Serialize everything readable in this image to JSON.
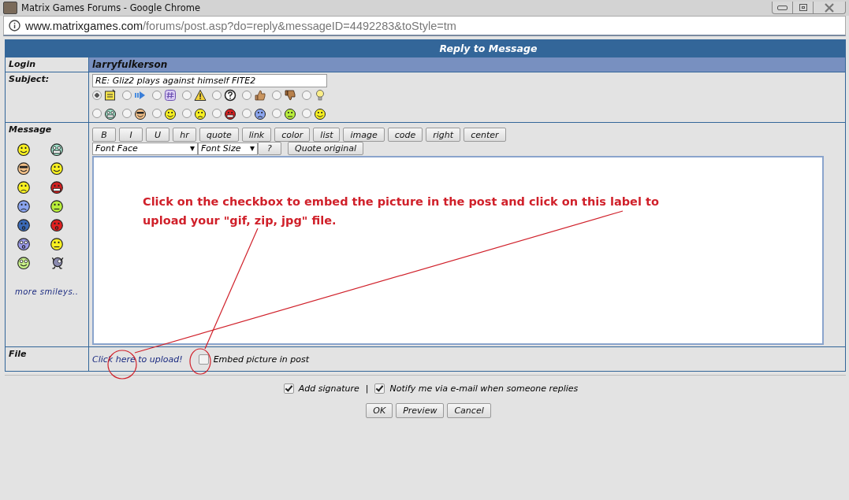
{
  "window": {
    "title": "Matrix Games Forums - Google Chrome"
  },
  "address_bar": {
    "domain": "www.matrixgames.com",
    "path": "/forums/post.asp?do=reply&messageID=4492283&toStyle=tm"
  },
  "form": {
    "title": "Reply to Message",
    "login": {
      "label": "Login",
      "value": "larryfulkerson"
    },
    "subject": {
      "label": "Subject:",
      "value": "RE: Gliz2 plays against himself FITE2",
      "post_icons": [
        {
          "selected": true
        },
        {
          "selected": false
        },
        {
          "selected": false
        },
        {
          "selected": false
        },
        {
          "selected": false
        },
        {
          "selected": false
        },
        {
          "selected": false
        },
        {
          "selected": false
        },
        {
          "selected": false
        },
        {
          "selected": false
        },
        {
          "selected": false
        },
        {
          "selected": false
        },
        {
          "selected": false
        },
        {
          "selected": false
        },
        {
          "selected": false
        },
        {
          "selected": false
        }
      ]
    },
    "message": {
      "label": "Message",
      "more_smileys": "more smileys..",
      "format_buttons": [
        "B",
        "I",
        "U",
        "hr",
        "quote",
        "link",
        "color",
        "list",
        "image",
        "code",
        "right",
        "center"
      ],
      "font_face": "Font Face",
      "font_size": "Font Size",
      "help_button": "?",
      "quote_button": "Quote original",
      "annotation": "Click on the checkbox to embed the picture in the post and click on this label to upload your \"gif, zip, jpg\" file."
    },
    "file": {
      "label": "File",
      "upload_link": "Click here to upload!",
      "embed": {
        "label": "Embed picture in post",
        "checked": false
      }
    }
  },
  "options": [
    {
      "label": "Add signature",
      "checked": true
    },
    {
      "label": "Notify me via e-mail when someone replies",
      "checked": true
    }
  ],
  "options_separator": "|",
  "buttons": [
    "OK",
    "Preview",
    "Cancel"
  ]
}
